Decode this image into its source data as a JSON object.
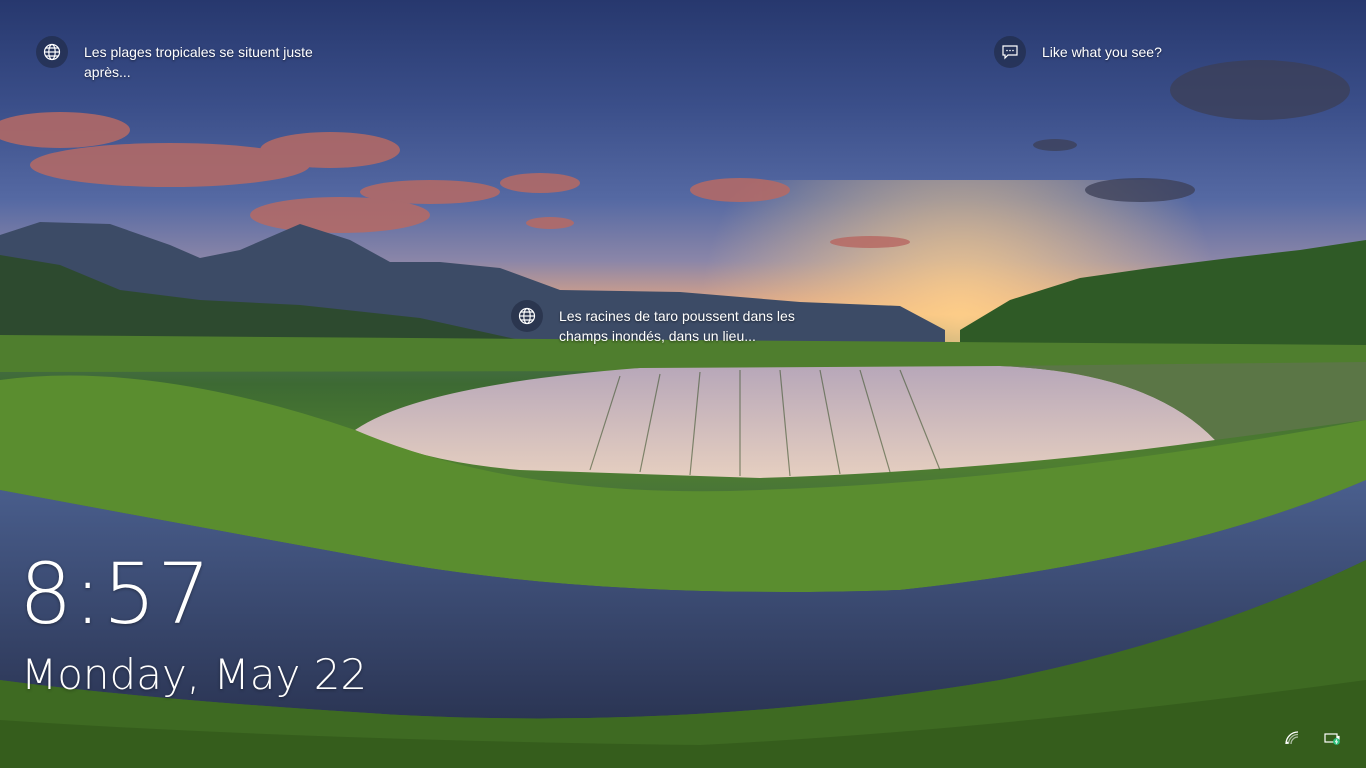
{
  "lockscreen": {
    "spotlight": {
      "hotspot_1_text": "Les plages tropicales se situent juste après...",
      "hotspot_2_text": "Les racines de taro poussent dans les champs inondés, dans un lieu...",
      "feedback_text": "Like what you see?"
    },
    "clock": {
      "time": "8:57",
      "date": "Monday, May 22"
    },
    "status": {
      "network_icon": "wifi-icon",
      "power_icon": "battery-charging-icon"
    }
  }
}
